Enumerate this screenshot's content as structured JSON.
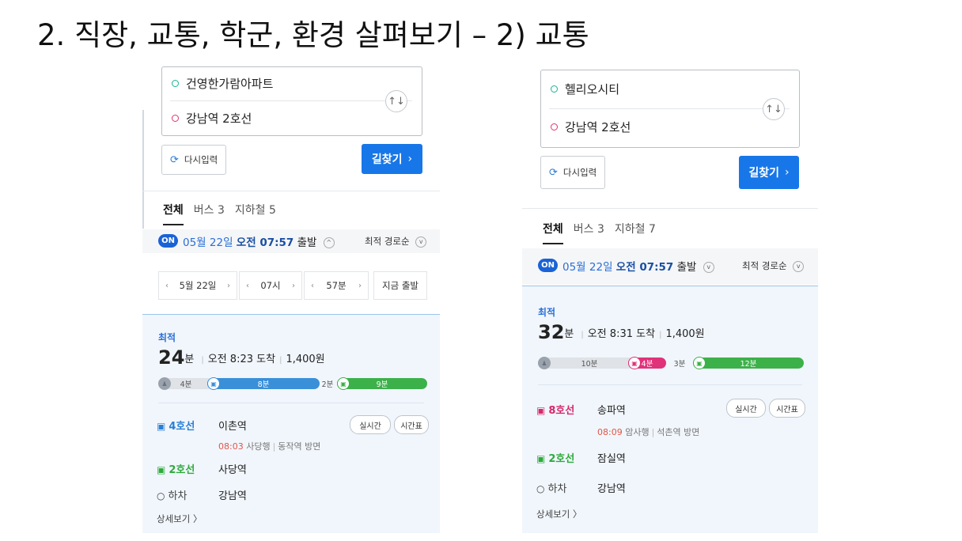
{
  "slide": {
    "title": "2. 직장, 교통, 학군, 환경 살펴보기 – 2) 교통"
  },
  "left": {
    "origin": "건영한가람아파트",
    "destination": "강남역 2호선",
    "swap_icon": "↑↓",
    "reset_label": "다시입력",
    "find_label": "길찾기",
    "tabs": [
      "전체",
      "버스 3",
      "지하철 5"
    ],
    "on_badge": "ON",
    "date": "05월 22일",
    "time": "오전 07:57",
    "depart": "출발",
    "sort_label": "최적 경로순",
    "pickers": {
      "date": "5월 22일",
      "hour": "07시",
      "minute": "57분",
      "now": "지금 출발"
    },
    "result": {
      "best": "최적",
      "minutes": "24",
      "unit": "분",
      "arrival": "오전 8:23 도착",
      "fare": "1,400원",
      "segments": [
        "4분",
        "8분",
        "2분",
        "9분"
      ],
      "legs": [
        {
          "line": "4호선",
          "station": "이촌역",
          "time": "08:03",
          "direction": "사당행",
          "exit": "동작역 방면"
        },
        {
          "line": "2호선",
          "station": "사당역"
        },
        {
          "line": "하차",
          "station": "강남역"
        }
      ],
      "buttons": [
        "실시간",
        "시간표"
      ],
      "detail": "상세보기 〉"
    }
  },
  "right": {
    "origin": "헬리오시티",
    "destination": "강남역 2호선",
    "swap_icon": "↑↓",
    "reset_label": "다시입력",
    "find_label": "길찾기",
    "tabs": [
      "전체",
      "버스 3",
      "지하철 7"
    ],
    "on_badge": "ON",
    "date": "05월 22일",
    "time": "오전 07:57",
    "depart": "출발",
    "sort_label": "최적 경로순",
    "result": {
      "best": "최적",
      "minutes": "32",
      "unit": "분",
      "arrival": "오전 8:31 도착",
      "fare": "1,400원",
      "segments": [
        "10분",
        "4분",
        "3분",
        "12분"
      ],
      "legs": [
        {
          "line": "8호선",
          "station": "송파역",
          "time": "08:09",
          "direction": "암사행",
          "exit": "석촌역 방면"
        },
        {
          "line": "2호선",
          "station": "잠실역"
        },
        {
          "line": "하차",
          "station": "강남역"
        }
      ],
      "buttons": [
        "실시간",
        "시간표"
      ],
      "detail": "상세보기 〉"
    }
  },
  "colors": {
    "primary": "#1877e8",
    "line4": "#3a8fd9",
    "line2": "#3cb14a",
    "line8": "#e0327a",
    "result_bg": "#f1f6fc"
  },
  "icons": [
    "swap-icon",
    "refresh-icon",
    "chevron-right-icon",
    "subway-icon",
    "walk-icon",
    "chevron-down-icon"
  ]
}
